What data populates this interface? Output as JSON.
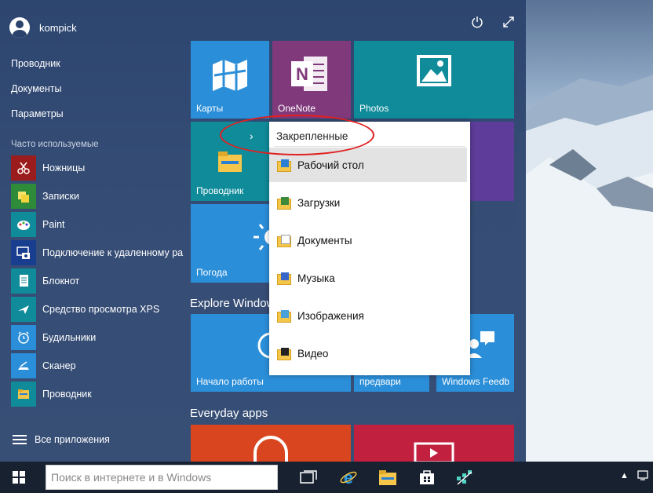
{
  "user": {
    "name": "kompick"
  },
  "top_icons": {
    "power": "power-icon",
    "expand": "expand-icon"
  },
  "left_links": [
    "Проводник",
    "Документы",
    "Параметры"
  ],
  "most_used_label": "Часто используемые",
  "most_used": [
    {
      "label": "Ножницы",
      "icon": "scissors-icon"
    },
    {
      "label": "Записки",
      "icon": "sticky-notes-icon"
    },
    {
      "label": "Paint",
      "icon": "paint-icon"
    },
    {
      "label": "Подключение к удаленному ра",
      "icon": "remote-desktop-icon"
    },
    {
      "label": "Блокнот",
      "icon": "notepad-icon"
    },
    {
      "label": "Средство просмотра XPS",
      "icon": "xps-viewer-icon"
    },
    {
      "label": "Будильники",
      "icon": "alarm-icon"
    },
    {
      "label": "Сканер",
      "icon": "scanner-icon"
    },
    {
      "label": "Проводник",
      "icon": "file-explorer-icon"
    }
  ],
  "all_apps_label": "Все приложения",
  "tiles": {
    "maps": "Карты",
    "onenote": "OneNote",
    "photos": "Photos",
    "explorer": "Проводник",
    "weather": "Погода",
    "getting_started": "Начало работы",
    "insider_hub": "Центр предвари",
    "windows_feedback": "Windows Feedb"
  },
  "groups": {
    "explore": "Explore Windows",
    "everyday": "Everyday apps"
  },
  "jump_list": {
    "header": "Закрепленные",
    "items": [
      {
        "label": "Рабочий стол",
        "icon": "desktop-folder-icon",
        "active": true
      },
      {
        "label": "Загрузки",
        "icon": "downloads-folder-icon"
      },
      {
        "label": "Документы",
        "icon": "documents-folder-icon"
      },
      {
        "label": "Музыка",
        "icon": "music-folder-icon"
      },
      {
        "label": "Изображения",
        "icon": "pictures-folder-icon"
      },
      {
        "label": "Видео",
        "icon": "videos-folder-icon"
      }
    ]
  },
  "taskbar": {
    "search_placeholder": "Поиск в интернете и в Windows",
    "apps": [
      "task-view-icon",
      "internet-explorer-icon",
      "file-explorer-icon",
      "store-icon",
      "app-icon"
    ]
  },
  "colors": {
    "start_bg": "#2b436c",
    "tile_blue": "#2b8ed8",
    "tile_teal": "#0f8b9a",
    "tile_onenote": "#80397b",
    "tile_purple": "#5d3c9a",
    "tile_red": "#d9451e",
    "tile_crimson": "#c2203f",
    "annotation": "#e02020",
    "taskbar": "#172130"
  }
}
